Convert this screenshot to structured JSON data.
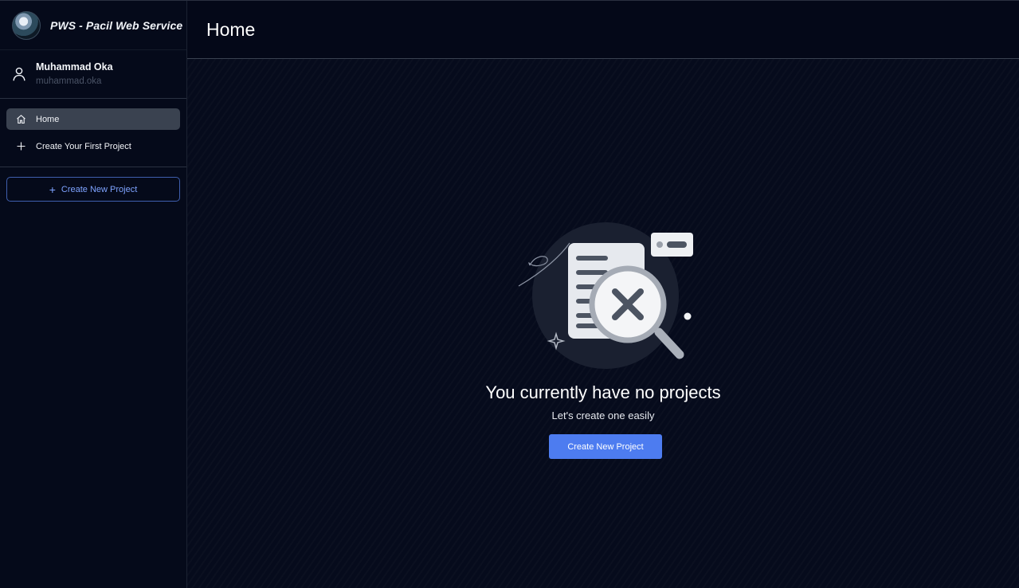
{
  "brand": {
    "name": "PWS - Pacil Web Service",
    "logo_icon": "brand-logo"
  },
  "user": {
    "name": "Muhammad Oka",
    "handle": "muhammad.oka",
    "icon": "user-icon"
  },
  "sidebar": {
    "items": [
      {
        "label": "Home",
        "icon": "home-icon",
        "active": true
      },
      {
        "label": "Create Your First Project",
        "icon": "plus-icon",
        "active": false
      }
    ],
    "create_button": {
      "label": "Create New Project",
      "icon": "plus-icon"
    }
  },
  "header": {
    "title": "Home"
  },
  "empty_state": {
    "title": "You currently have no projects",
    "subtitle": "Let's create one easily",
    "button_label": "Create New Project",
    "illustration": "no-results-document-icon"
  },
  "colors": {
    "background": "#04081a",
    "accent": "#4d7cf0",
    "accent_outline": "#3f5fae",
    "active_nav": "#3a4250"
  }
}
